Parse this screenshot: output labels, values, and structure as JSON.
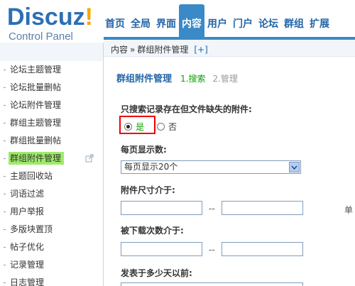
{
  "header": {
    "logo_text": "Discuz",
    "logo_bang": "!",
    "logo_sub": "Control Panel",
    "nav": [
      {
        "label": "首页"
      },
      {
        "label": "全局"
      },
      {
        "label": "界面"
      },
      {
        "label": "内容",
        "active": true
      },
      {
        "label": "用户"
      },
      {
        "label": "门户"
      },
      {
        "label": "论坛"
      },
      {
        "label": "群组"
      },
      {
        "label": "扩展"
      }
    ]
  },
  "sidebar": {
    "items": [
      {
        "label": "论坛主题管理"
      },
      {
        "label": "论坛批量删帖"
      },
      {
        "label": "论坛附件管理"
      },
      {
        "label": "群组主题管理"
      },
      {
        "label": "群组批量删帖"
      },
      {
        "label": "群组附件管理",
        "active": true
      },
      {
        "label": "主题回收站"
      },
      {
        "label": "词语过滤"
      },
      {
        "label": "用户举报"
      },
      {
        "label": "多版块置顶"
      },
      {
        "label": "帖子优化"
      },
      {
        "label": "记录管理"
      },
      {
        "label": "日志管理"
      }
    ]
  },
  "breadcrumb": {
    "root": "内容",
    "separator": "»",
    "current": "群组附件管理",
    "add": "[+]"
  },
  "page": {
    "title": "群组附件管理",
    "step1": "1.搜索",
    "step2": "2.管理"
  },
  "form": {
    "missing_label": "只搜索记录存在但文件缺失的附件:",
    "yes": "是",
    "no": "否",
    "perpage_label": "每页显示数:",
    "perpage_value": "每页显示20个",
    "size_label": "附件尺寸介于:",
    "size_unit_cut": "单",
    "dash": "--",
    "downloads_label": "被下载次数介于:",
    "days_label": "发表于多少天以前:"
  },
  "colors": {
    "accent": "#3a8ac7",
    "link": "#2366a8",
    "active_green": "#9eea6a",
    "step_green": "#09a200",
    "highlight_red": "#ee0000"
  }
}
